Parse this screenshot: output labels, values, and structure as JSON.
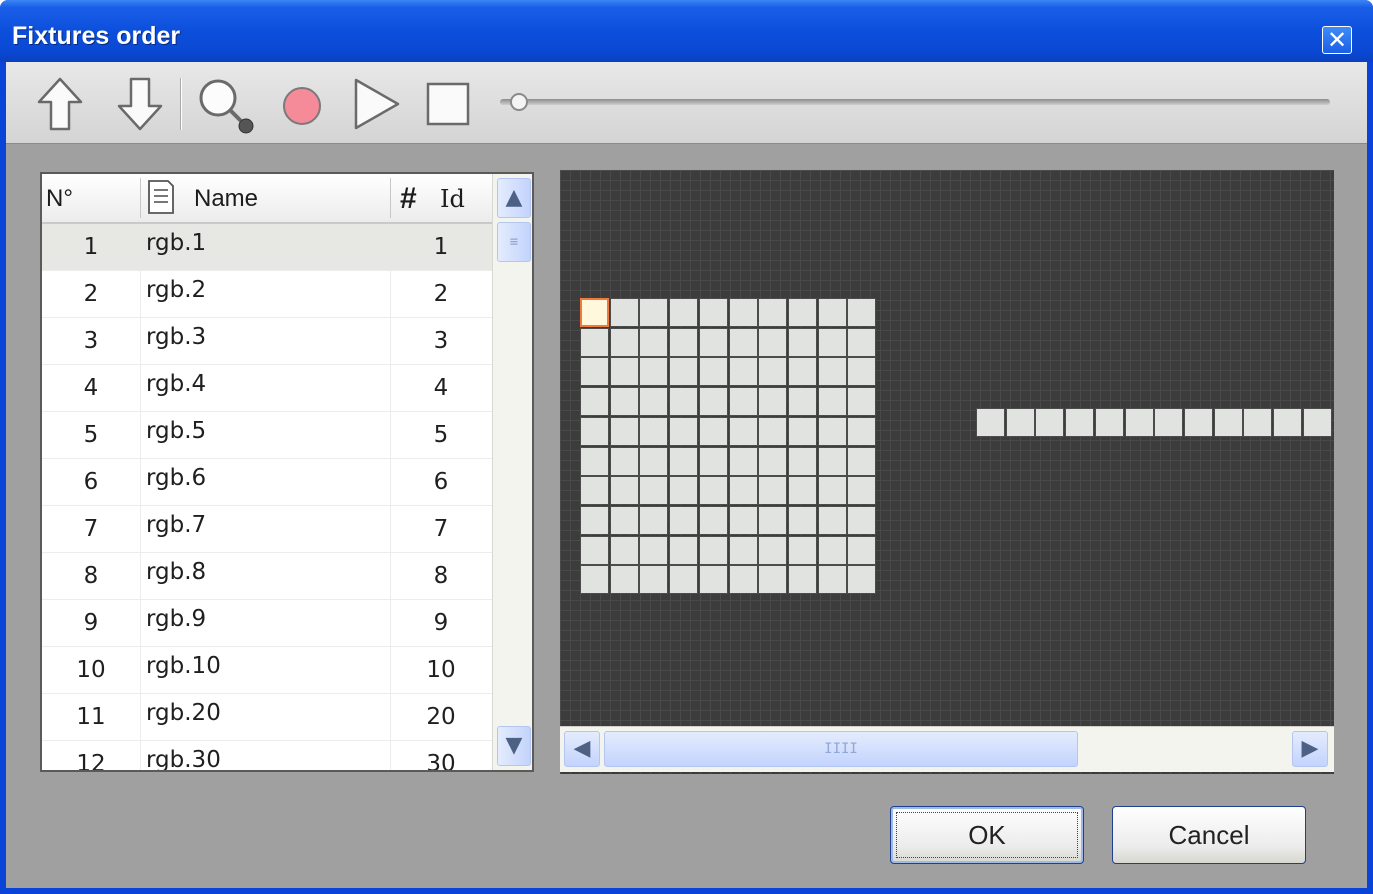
{
  "window": {
    "title": "Fixtures order",
    "close_glyph": "✕"
  },
  "toolbar": {
    "icons": [
      "arrow-up-icon",
      "arrow-down-icon",
      "magnifier-icon",
      "record-icon",
      "play-icon",
      "stop-icon"
    ],
    "slider_value": 0
  },
  "list": {
    "columns": {
      "num": "N°",
      "name": "Name",
      "id": "Id"
    },
    "rows": [
      {
        "num": "1",
        "name": "rgb.1",
        "id": "1"
      },
      {
        "num": "2",
        "name": "rgb.2",
        "id": "2"
      },
      {
        "num": "3",
        "name": "rgb.3",
        "id": "3"
      },
      {
        "num": "4",
        "name": "rgb.4",
        "id": "4"
      },
      {
        "num": "5",
        "name": "rgb.5",
        "id": "5"
      },
      {
        "num": "6",
        "name": "rgb.6",
        "id": "6"
      },
      {
        "num": "7",
        "name": "rgb.7",
        "id": "7"
      },
      {
        "num": "8",
        "name": "rgb.8",
        "id": "8"
      },
      {
        "num": "9",
        "name": "rgb.9",
        "id": "9"
      },
      {
        "num": "10",
        "name": "rgb.10",
        "id": "10"
      },
      {
        "num": "11",
        "name": "rgb.20",
        "id": "20"
      },
      {
        "num": "12",
        "name": "rgb.30",
        "id": "30"
      }
    ],
    "selected_index": 0
  },
  "grid": {
    "block_columns": 10,
    "block_rows": 10,
    "row_strip_cells": 12,
    "highlighted_cell": 0
  },
  "buttons": {
    "ok": "OK",
    "cancel": "Cancel"
  },
  "scroll": {
    "up": "▲",
    "down": "▼",
    "left": "◀",
    "right": "▶",
    "grip_v": "≡",
    "grip_h": "IIII"
  }
}
